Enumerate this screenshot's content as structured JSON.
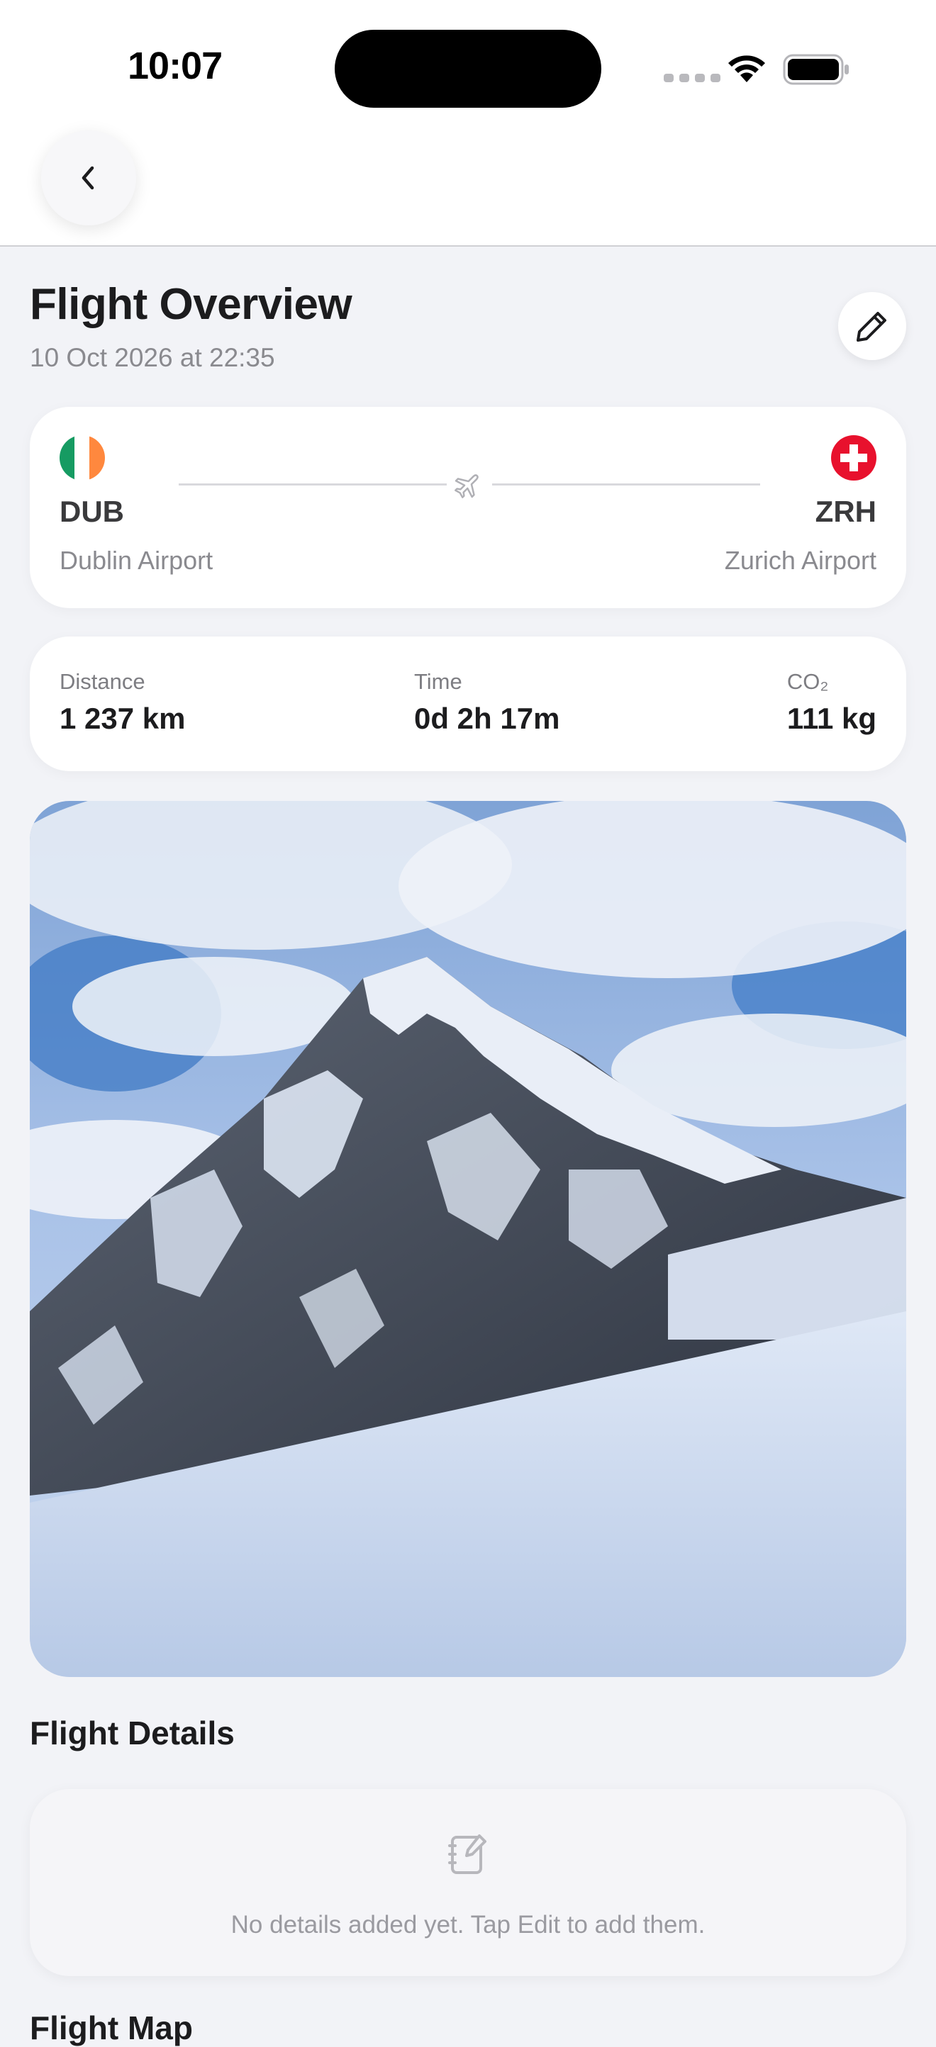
{
  "status_bar": {
    "time": "10:07"
  },
  "nav": {
    "back_icon": "chevron-left-icon"
  },
  "header": {
    "title": "Flight Overview",
    "subtitle": "10 Oct 2026 at 22:35",
    "edit_icon": "pencil-icon"
  },
  "route": {
    "from": {
      "code": "DUB",
      "airport": "Dublin Airport",
      "flag": "ireland-flag"
    },
    "to": {
      "code": "ZRH",
      "airport": "Zurich Airport",
      "flag": "switzerland-flag"
    },
    "plane_icon": "airplane-icon"
  },
  "stats": {
    "distance": {
      "label": "Distance",
      "value": "1 237 km"
    },
    "time": {
      "label": "Time",
      "value": "0d 2h 17m"
    },
    "co2": {
      "label": "CO₂",
      "value": "111 kg"
    }
  },
  "photo": {
    "subject": "snow-covered mountain peak under blue sky"
  },
  "details": {
    "title": "Flight Details",
    "empty_text": "No details added yet. Tap Edit to add them.",
    "icon": "notes-edit-icon"
  },
  "map": {
    "title": "Flight Map"
  },
  "colors": {
    "background": "#f2f3f7",
    "card": "#ffffff",
    "secondary_text": "#8a8a8f",
    "ireland_green": "#169b62",
    "ireland_orange": "#ff883e",
    "swiss_red": "#e8112d"
  }
}
